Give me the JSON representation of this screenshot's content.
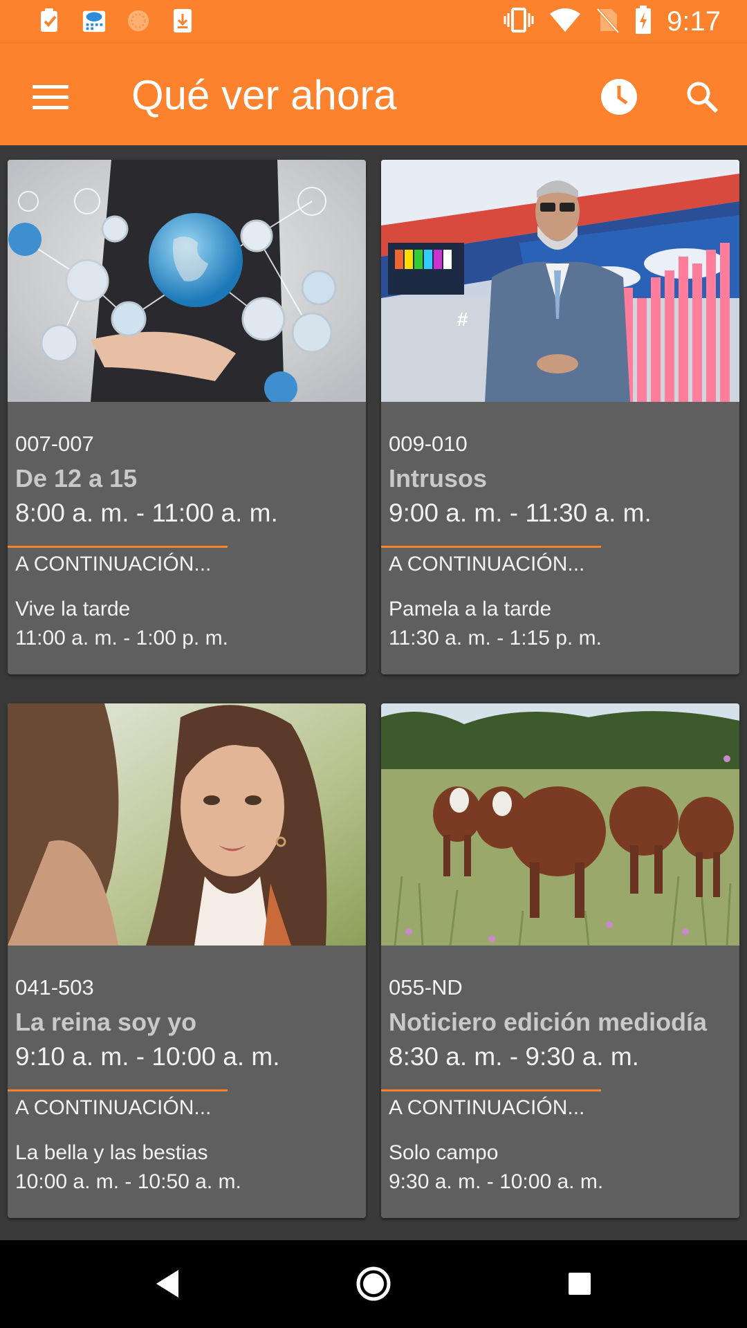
{
  "status_bar": {
    "time": "9:17",
    "left_icons": [
      "task-icon",
      "cloud-calendar-icon",
      "sun-icon",
      "download-icon"
    ],
    "right_icons": [
      "vibrate-icon",
      "wifi-icon",
      "no-sim-icon",
      "battery-charging-icon"
    ]
  },
  "app_bar": {
    "title": "Qué ver ahora",
    "icons": [
      "menu-icon",
      "clock-icon",
      "search-icon"
    ],
    "accent": "#fd822d"
  },
  "cards": [
    {
      "channel": "007-007",
      "program": "De 12 a 15",
      "time": "8:00 a. m. - 11:00 a. m.",
      "next_label": "A CONTINUACIÓN...",
      "next_program": "Vive la tarde",
      "next_time": "11:00 a. m. - 1:00 p. m."
    },
    {
      "channel": "009-010",
      "program": "Intrusos",
      "time": "9:00 a. m. - 11:30 a. m.",
      "next_label": "A CONTINUACIÓN...",
      "next_program": "Pamela a la tarde",
      "next_time": "11:30 a. m. - 1:15 p. m."
    },
    {
      "channel": "041-503",
      "program": "La reina soy yo",
      "time": "9:10 a. m. - 10:00 a. m.",
      "next_label": "A CONTINUACIÓN...",
      "next_program": "La bella y las bestias",
      "next_time": "10:00 a. m. - 10:50 a. m."
    },
    {
      "channel": "055-ND",
      "program": "Noticiero edición mediodía",
      "time": "8:30 a. m. - 9:30 a. m.",
      "next_label": "A CONTINUACIÓN...",
      "next_program": "Solo campo",
      "next_time": "9:30 a. m. - 10:00 a. m."
    }
  ],
  "nav_bar": {
    "icons": [
      "back-icon",
      "home-icon",
      "recents-icon"
    ]
  }
}
